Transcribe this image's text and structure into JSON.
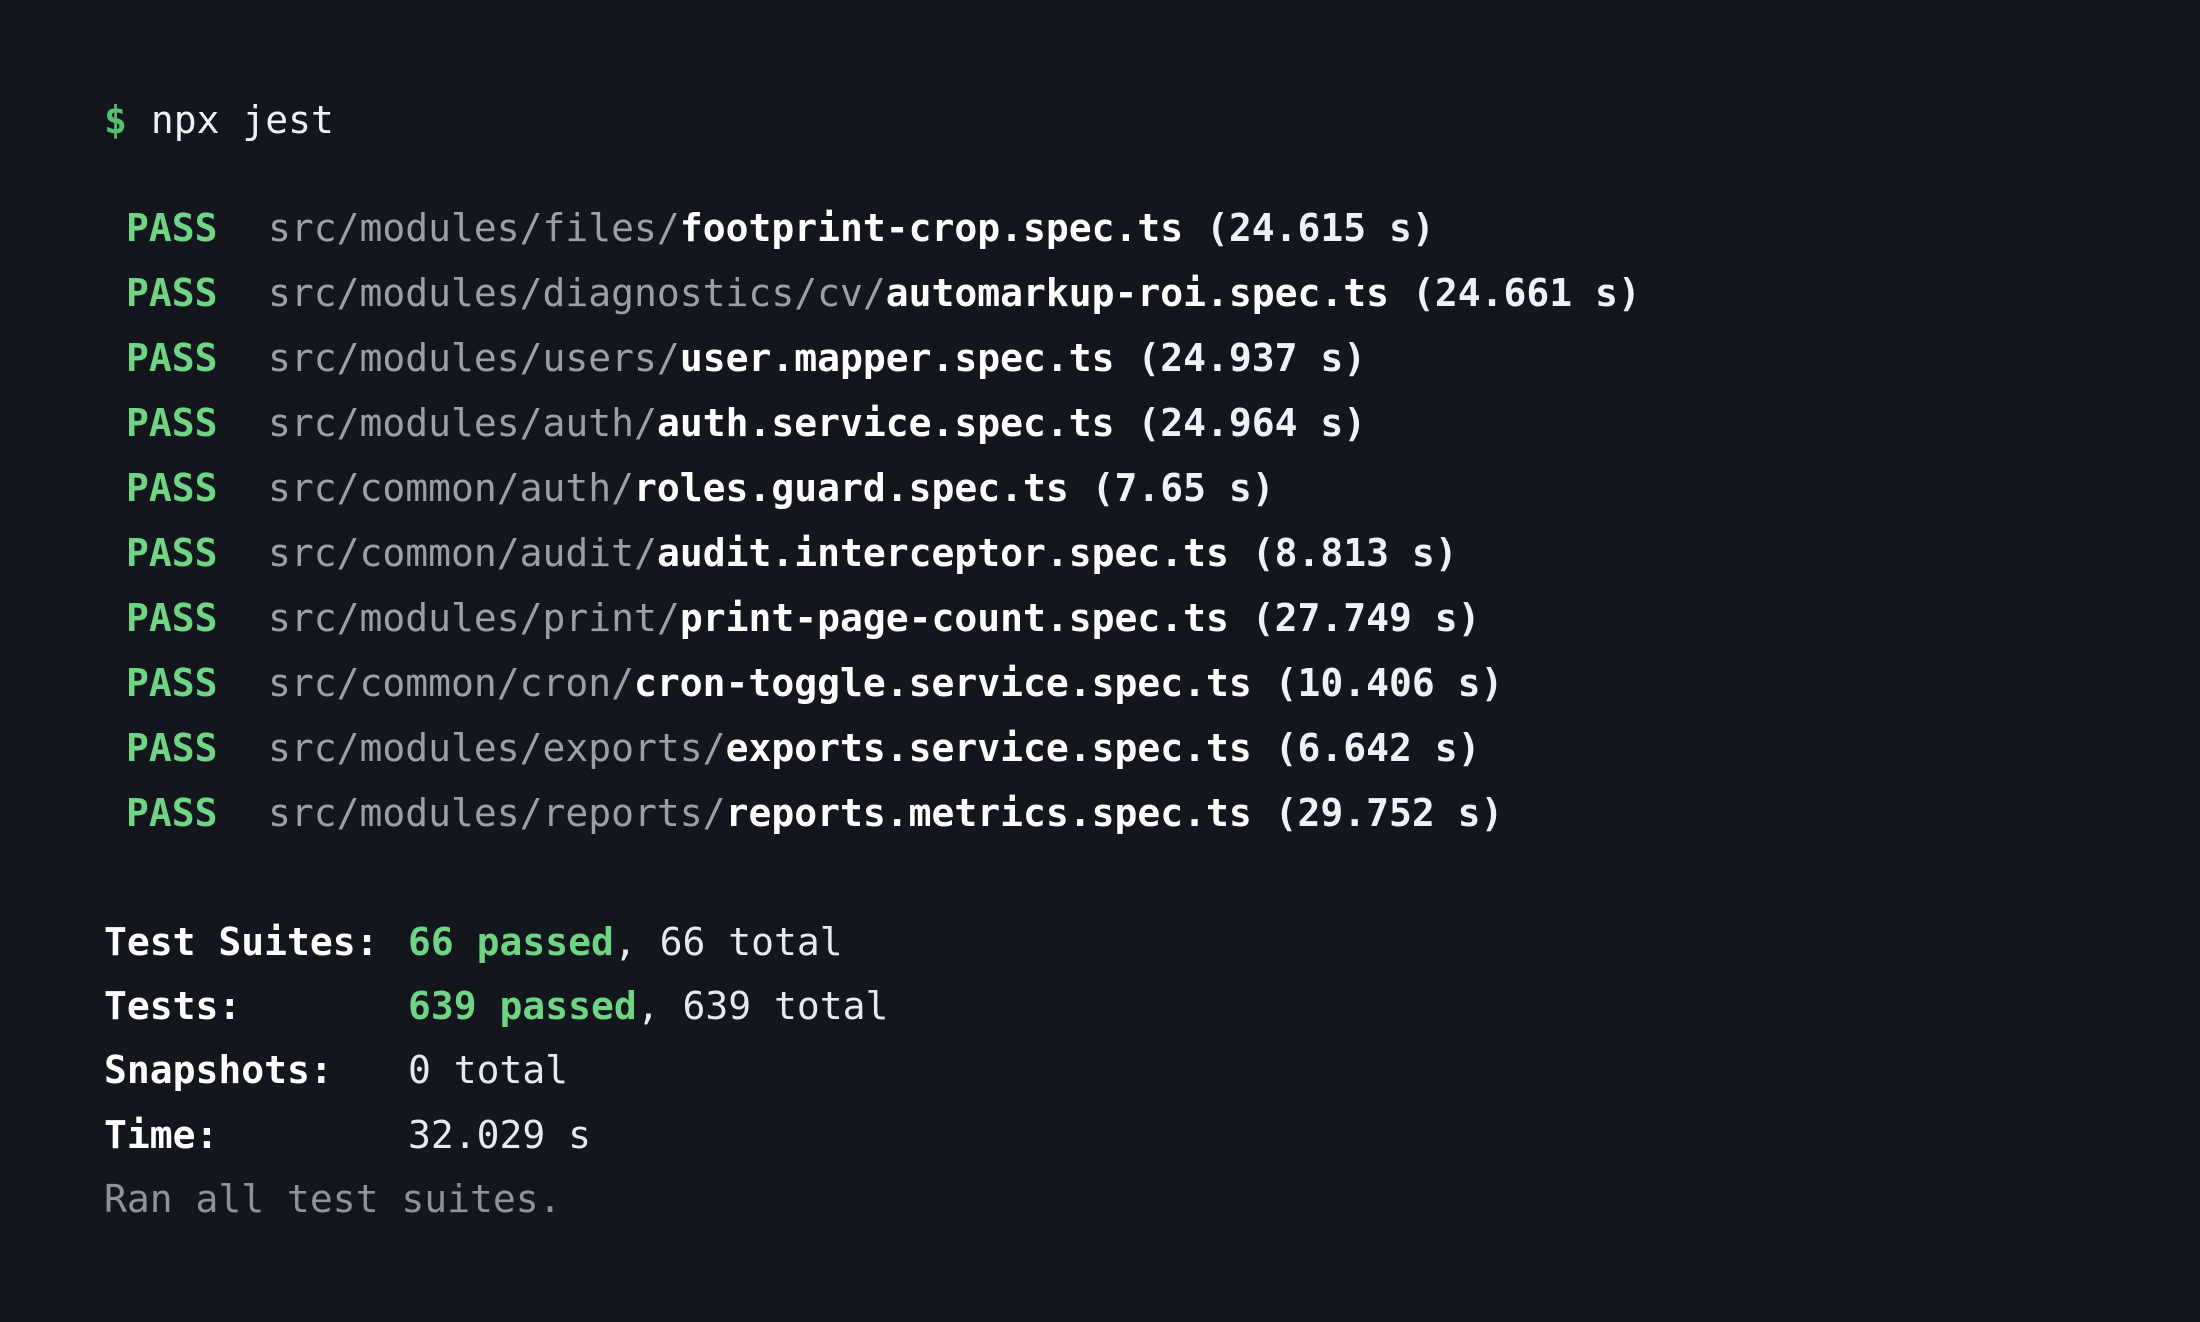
{
  "command": {
    "prompt": "$",
    "text": "npx jest"
  },
  "results": [
    {
      "status": "PASS",
      "dir": "src/modules/files/",
      "file": "footprint-crop.spec.ts",
      "duration": "(24.615 s)"
    },
    {
      "status": "PASS",
      "dir": "src/modules/diagnostics/cv/",
      "file": "automarkup-roi.spec.ts",
      "duration": "(24.661 s)"
    },
    {
      "status": "PASS",
      "dir": "src/modules/users/",
      "file": "user.mapper.spec.ts",
      "duration": "(24.937 s)"
    },
    {
      "status": "PASS",
      "dir": "src/modules/auth/",
      "file": "auth.service.spec.ts",
      "duration": "(24.964 s)"
    },
    {
      "status": "PASS",
      "dir": "src/common/auth/",
      "file": "roles.guard.spec.ts",
      "duration": "(7.65 s)"
    },
    {
      "status": "PASS",
      "dir": "src/common/audit/",
      "file": "audit.interceptor.spec.ts",
      "duration": "(8.813 s)"
    },
    {
      "status": "PASS",
      "dir": "src/modules/print/",
      "file": "print-page-count.spec.ts",
      "duration": "(27.749 s)"
    },
    {
      "status": "PASS",
      "dir": "src/common/cron/",
      "file": "cron-toggle.service.spec.ts",
      "duration": "(10.406 s)"
    },
    {
      "status": "PASS",
      "dir": "src/modules/exports/",
      "file": "exports.service.spec.ts",
      "duration": "(6.642 s)"
    },
    {
      "status": "PASS",
      "dir": "src/modules/reports/",
      "file": "reports.metrics.spec.ts",
      "duration": "(29.752 s)"
    }
  ],
  "summary": {
    "suites": {
      "label": "Test Suites:",
      "passed": "66 passed",
      "rest": ", 66 total"
    },
    "tests": {
      "label": "Tests:",
      "passed": "639 passed",
      "rest": ", 639 total"
    },
    "snapshots": {
      "label": "Snapshots:",
      "value": "0 total"
    },
    "time": {
      "label": "Time:",
      "value": "32.029 s"
    },
    "footer": "Ran all test suites."
  },
  "colors": {
    "background": "#13161d",
    "pass": "#6fd483",
    "prompt": "#56c271",
    "dim": "#9aa0a8"
  }
}
